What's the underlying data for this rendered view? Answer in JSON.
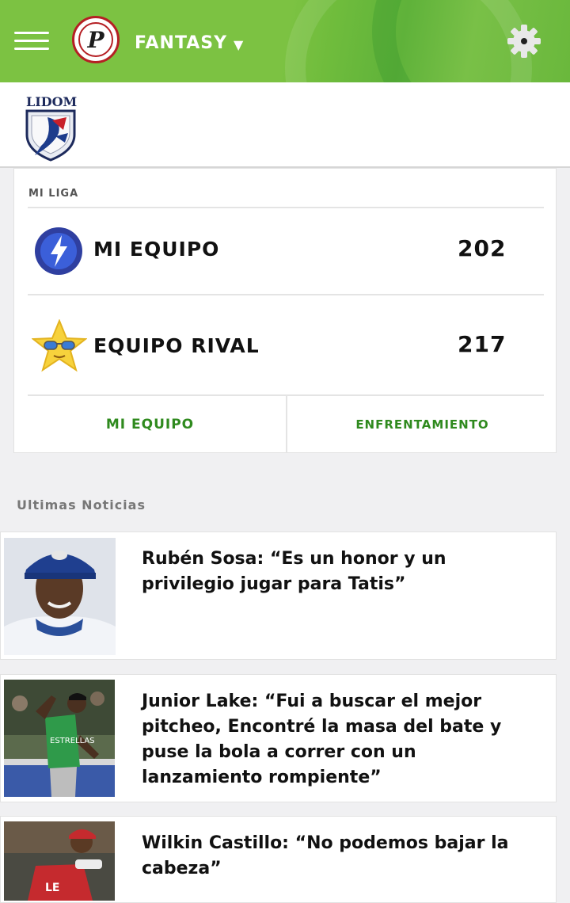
{
  "header": {
    "brand_label": "FANTASY",
    "menu_icon": "hamburger-menu-icon",
    "logo_letter": "P",
    "settings_icon": "gear-icon",
    "brand_color": "#7cc242"
  },
  "league_logo": {
    "text": "LIDOM"
  },
  "mi_liga": {
    "title": "MI LIGA",
    "my_team": {
      "name": "MI EQUIPO",
      "score": "202",
      "icon": "lightning-bolt-icon"
    },
    "rival_team": {
      "name": "EQUIPO RIVAL",
      "score": "217",
      "icon": "star-sunglasses-icon"
    },
    "tabs": [
      {
        "label": "MI EQUIPO"
      },
      {
        "label": "ENFRENTAMIENTO"
      }
    ],
    "accent_color": "#2f8a1e"
  },
  "news": {
    "title": "Ultimas Noticias",
    "items": [
      {
        "headline": "Rubén Sosa: “Es un honor y un privilegio jugar para Tatis”"
      },
      {
        "headline": "Junior Lake: “Fui a buscar el mejor pitcheo, Encontré la masa del bate y puse la bola a correr con un lanzamiento rompiente”"
      },
      {
        "headline": "Wilkin Castillo: “No podemos bajar la cabeza”"
      }
    ]
  }
}
